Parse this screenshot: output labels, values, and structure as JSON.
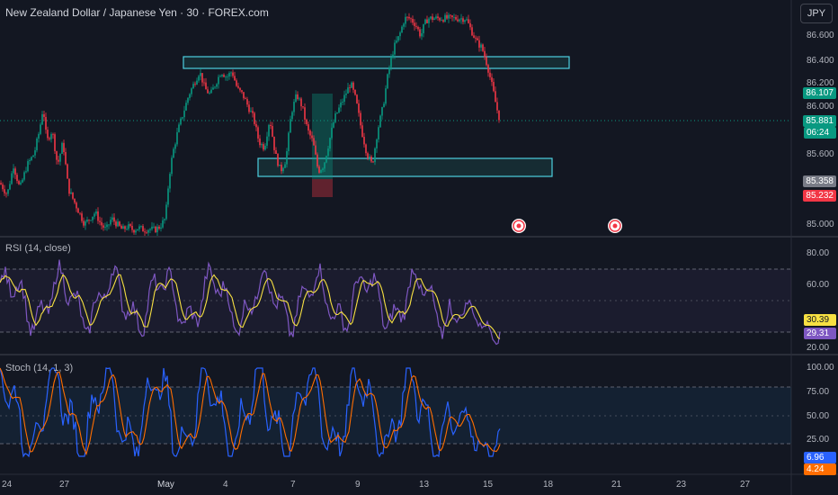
{
  "title": "New Zealand Dollar / Japanese Yen · 30 · FOREX.com",
  "currency_button": "JPY",
  "price_axis": {
    "ticks": [
      "86.600",
      "86.400",
      "86.200",
      "86.000",
      "85.800",
      "85.600",
      "85.400",
      "85.000"
    ],
    "tags": [
      {
        "label": "86.107",
        "color": "#089981"
      },
      {
        "label": "85.881",
        "color": "#089981"
      },
      {
        "label": "06:24",
        "color": "#089981"
      },
      {
        "label": "85.358",
        "color": "#787b86"
      },
      {
        "label": "85.232",
        "color": "#f23645"
      }
    ]
  },
  "rsi": {
    "label": "RSI (14, close)",
    "ticks": [
      "80.00",
      "60.00",
      "40.00",
      "20.00"
    ],
    "tags": [
      {
        "label": "30.39",
        "color": "#f7e042",
        "text": "#131722"
      },
      {
        "label": "29.31",
        "color": "#7e57c2",
        "text": "#ffffff"
      }
    ]
  },
  "stoch": {
    "label": "Stoch (14, 1, 3)",
    "ticks": [
      "100.00",
      "75.00",
      "50.00",
      "25.00"
    ],
    "tags": [
      {
        "label": "6.96",
        "color": "#2962ff",
        "text": "#ffffff"
      },
      {
        "label": "4.24",
        "color": "#ff6d00",
        "text": "#ffffff"
      }
    ]
  },
  "time_axis": [
    "24",
    "27",
    "May",
    "4",
    "7",
    "9",
    "13",
    "15",
    "18",
    "21",
    "23",
    "27"
  ],
  "chart_data": {
    "type": "candlestick",
    "title": "New Zealand Dollar / Japanese Yen · 30 · FOREX.com",
    "ylim": [
      84.95,
      86.75
    ],
    "x": [
      "24",
      "27",
      "May",
      "4",
      "7",
      "9",
      "13",
      "15"
    ],
    "close_path": [
      [
        0,
        85.35
      ],
      [
        8,
        85.25
      ],
      [
        15,
        85.5
      ],
      [
        22,
        85.3
      ],
      [
        30,
        85.5
      ],
      [
        38,
        85.6
      ],
      [
        44,
        85.8
      ],
      [
        48,
        86.0
      ],
      [
        52,
        85.7
      ],
      [
        58,
        85.8
      ],
      [
        64,
        85.5
      ],
      [
        70,
        85.7
      ],
      [
        76,
        85.3
      ],
      [
        82,
        85.2
      ],
      [
        88,
        85.1
      ],
      [
        94,
        85.0
      ],
      [
        100,
        85.05
      ],
      [
        106,
        85.1
      ],
      [
        112,
        85.0
      ],
      [
        118,
        84.95
      ],
      [
        124,
        85.05
      ],
      [
        130,
        85.0
      ],
      [
        136,
        84.95
      ],
      [
        142,
        84.98
      ],
      [
        148,
        84.95
      ],
      [
        154,
        84.97
      ],
      [
        160,
        84.95
      ],
      [
        166,
        84.96
      ],
      [
        172,
        84.95
      ],
      [
        178,
        84.98
      ],
      [
        184,
        85.05
      ],
      [
        188,
        85.4
      ],
      [
        192,
        85.6
      ],
      [
        198,
        85.8
      ],
      [
        204,
        85.95
      ],
      [
        210,
        86.1
      ],
      [
        216,
        86.2
      ],
      [
        222,
        86.3
      ],
      [
        228,
        86.15
      ],
      [
        234,
        86.1
      ],
      [
        240,
        86.2
      ],
      [
        246,
        86.3
      ],
      [
        252,
        86.25
      ],
      [
        258,
        86.3
      ],
      [
        264,
        86.15
      ],
      [
        270,
        86.1
      ],
      [
        276,
        86.0
      ],
      [
        282,
        85.9
      ],
      [
        288,
        85.7
      ],
      [
        294,
        85.65
      ],
      [
        300,
        85.9
      ],
      [
        306,
        85.6
      ],
      [
        312,
        85.45
      ],
      [
        318,
        85.55
      ],
      [
        324,
        85.95
      ],
      [
        330,
        86.1
      ],
      [
        336,
        86.0
      ],
      [
        342,
        85.8
      ],
      [
        348,
        85.7
      ],
      [
        354,
        85.45
      ],
      [
        360,
        85.5
      ],
      [
        366,
        85.7
      ],
      [
        372,
        85.9
      ],
      [
        378,
        86.0
      ],
      [
        384,
        86.1
      ],
      [
        390,
        86.2
      ],
      [
        396,
        86.05
      ],
      [
        402,
        85.8
      ],
      [
        408,
        85.6
      ],
      [
        414,
        85.5
      ],
      [
        420,
        85.8
      ],
      [
        426,
        86.0
      ],
      [
        432,
        86.3
      ],
      [
        438,
        86.5
      ],
      [
        444,
        86.6
      ],
      [
        450,
        86.75
      ],
      [
        456,
        86.75
      ],
      [
        462,
        86.7
      ],
      [
        468,
        86.6
      ],
      [
        472,
        86.7
      ],
      [
        476,
        86.75
      ],
      [
        500,
        86.75
      ],
      [
        518,
        86.75
      ],
      [
        524,
        86.65
      ],
      [
        530,
        86.55
      ],
      [
        536,
        86.5
      ],
      [
        542,
        86.35
      ],
      [
        548,
        86.15
      ],
      [
        552,
        86.0
      ],
      [
        556,
        85.88
      ]
    ],
    "annotations": [
      {
        "type": "zone",
        "from_x": "May",
        "price_low": 86.36,
        "price_high": 86.42
      },
      {
        "type": "zone",
        "from_x": "7",
        "price_low": 85.42,
        "price_high": 85.52
      }
    ]
  }
}
